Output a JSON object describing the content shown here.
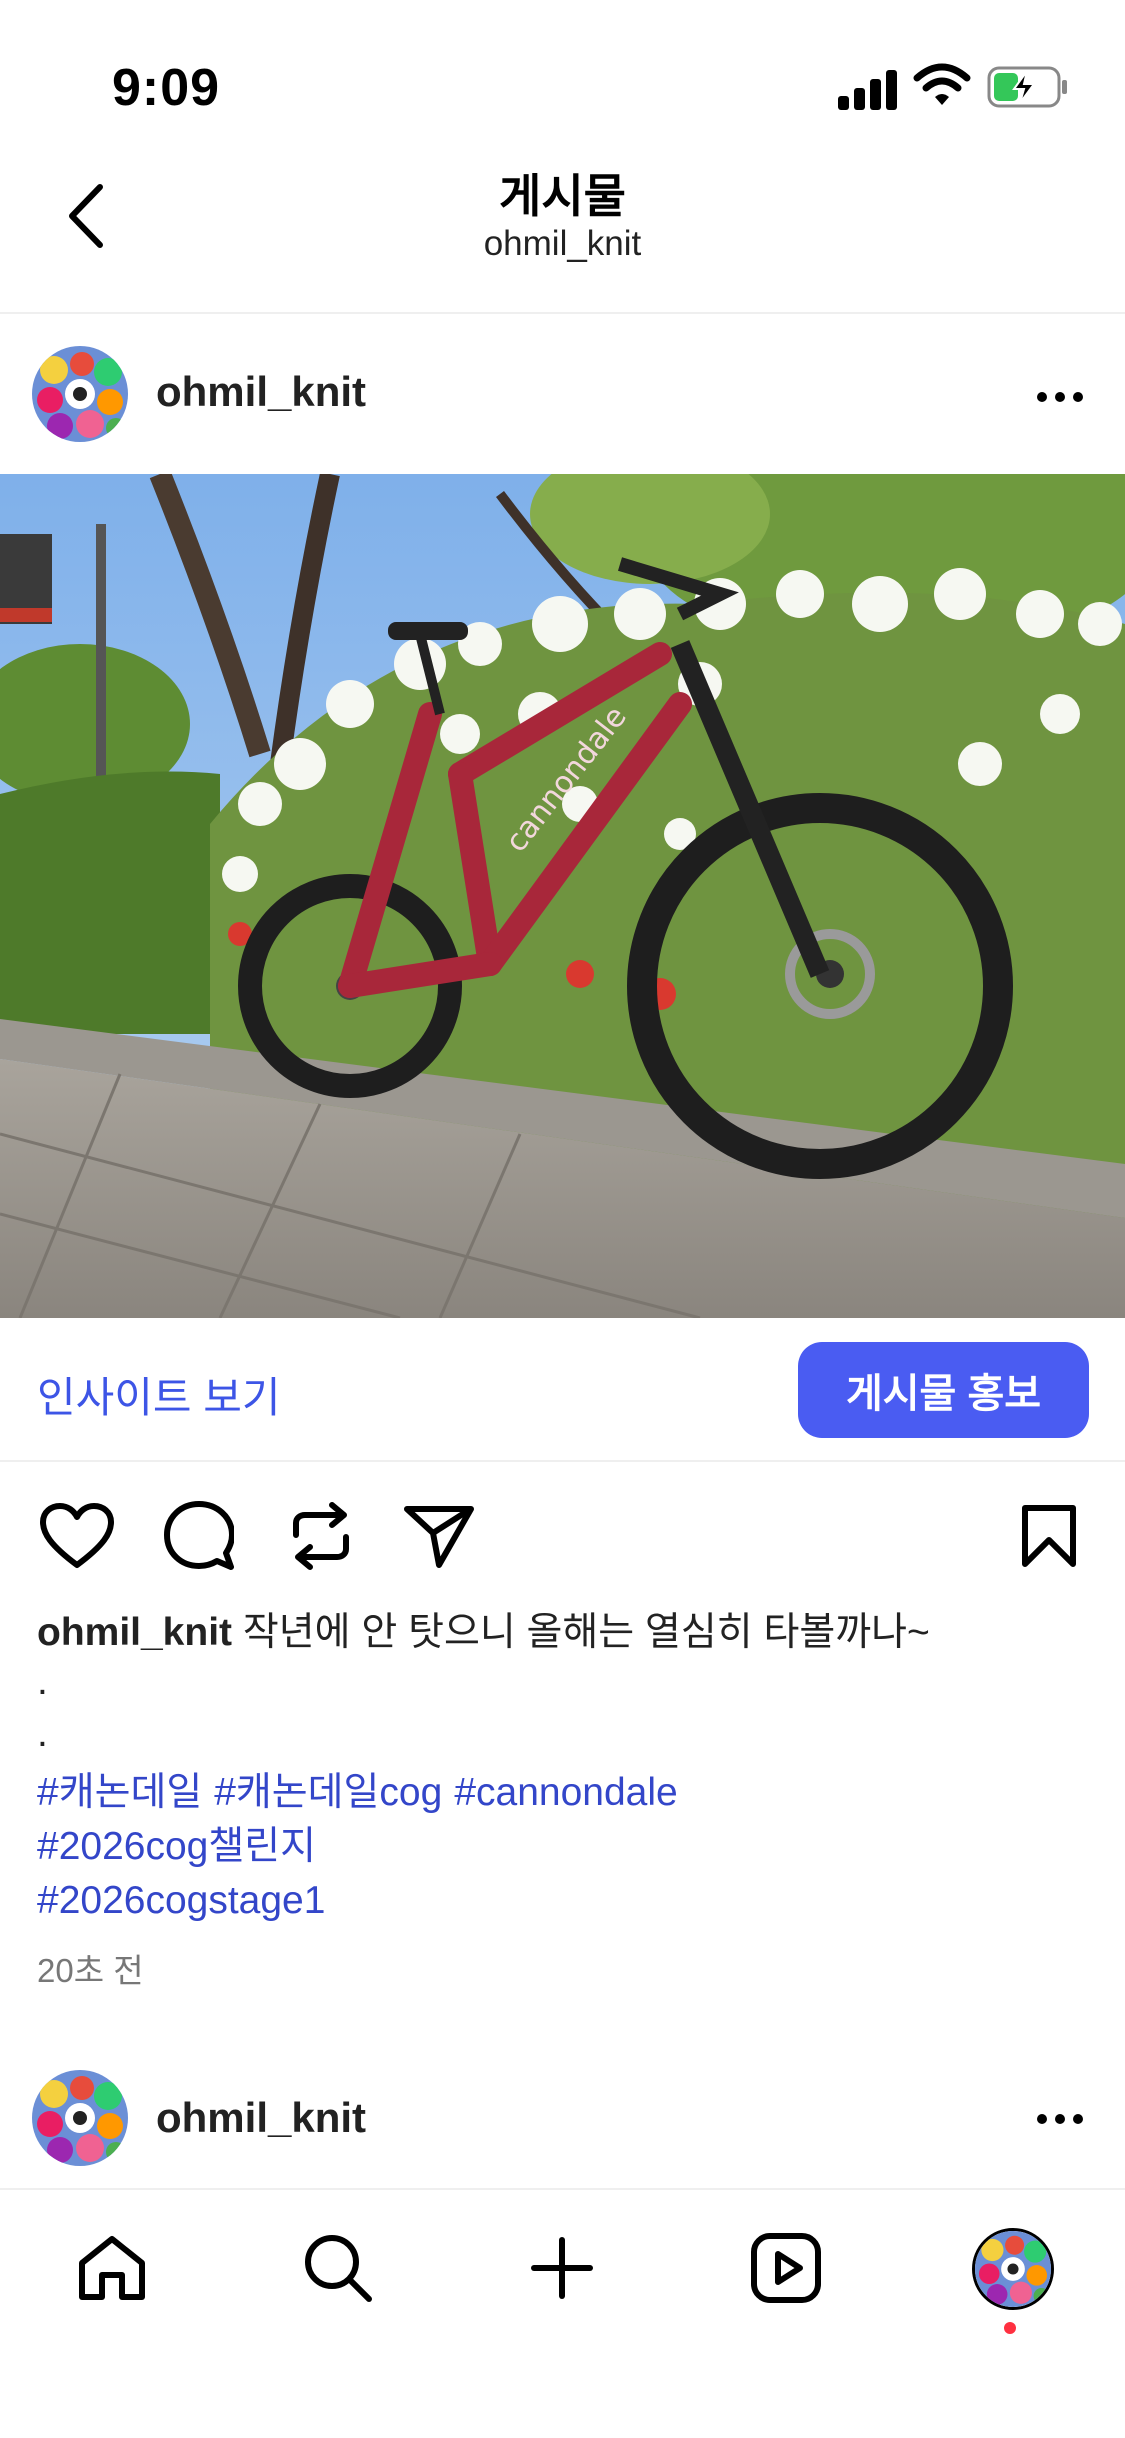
{
  "status_bar": {
    "time": "9:09"
  },
  "header": {
    "title": "게시물",
    "subtitle": "ohmil_knit",
    "back_icon": "chevron-left-icon"
  },
  "post": {
    "username": "ohmil_knit",
    "more_icon": "ellipsis-icon",
    "photo_alt": "red cannondale mountain bike leaning against a flowering hedge",
    "insights_label": "인사이트 보기",
    "promote_label": "게시물 홍보",
    "actions": [
      "heart-icon",
      "comment-icon",
      "repost-icon",
      "share-icon",
      "bookmark-icon"
    ],
    "caption_user": "ohmil_knit",
    "caption_text": "작년에 안 탓으니 올해는 열심히 타볼까나~",
    "caption_dot1": ".",
    "caption_dot2": ".",
    "hashtags_line1": [
      "#캐논데일",
      "#캐논데일cog",
      "#cannondale"
    ],
    "hashtags_line2": [
      "#2026cog챌린지"
    ],
    "hashtags_line3": [
      "#2026cogstage1"
    ],
    "time_ago": "20초 전"
  },
  "next_post": {
    "username": "ohmil_knit"
  },
  "colors": {
    "accent": "#4a5cf2",
    "link": "#3346c9"
  }
}
